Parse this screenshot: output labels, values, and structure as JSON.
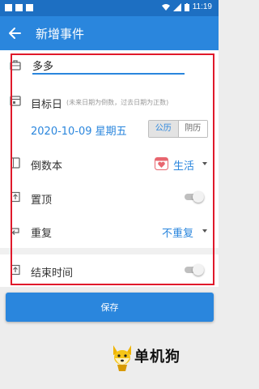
{
  "status_bar": {
    "time": "11:19"
  },
  "app_bar": {
    "title": "新增事件"
  },
  "form": {
    "name": {
      "value": "多多",
      "placeholder": ""
    },
    "target_date": {
      "label": "目标日",
      "hint": "(未来日期为倒数，过去日期为正数)",
      "date": "2020-10-09 星期五",
      "calendar_options": [
        "公历",
        "阴历"
      ],
      "calendar_selected": "公历"
    },
    "book": {
      "label": "倒数本",
      "value": "生活"
    },
    "pin_top": {
      "label": "置顶",
      "enabled": false
    },
    "repeat": {
      "label": "重复",
      "value": "不重复"
    },
    "end_time": {
      "label": "结束时间",
      "enabled": false
    }
  },
  "save_button": {
    "label": "保存"
  },
  "watermark": {
    "text": "单机狗"
  },
  "colors": {
    "primary": "#2a86dd",
    "status_bar": "#1d6fc2",
    "highlight_frame": "#e0192b"
  }
}
